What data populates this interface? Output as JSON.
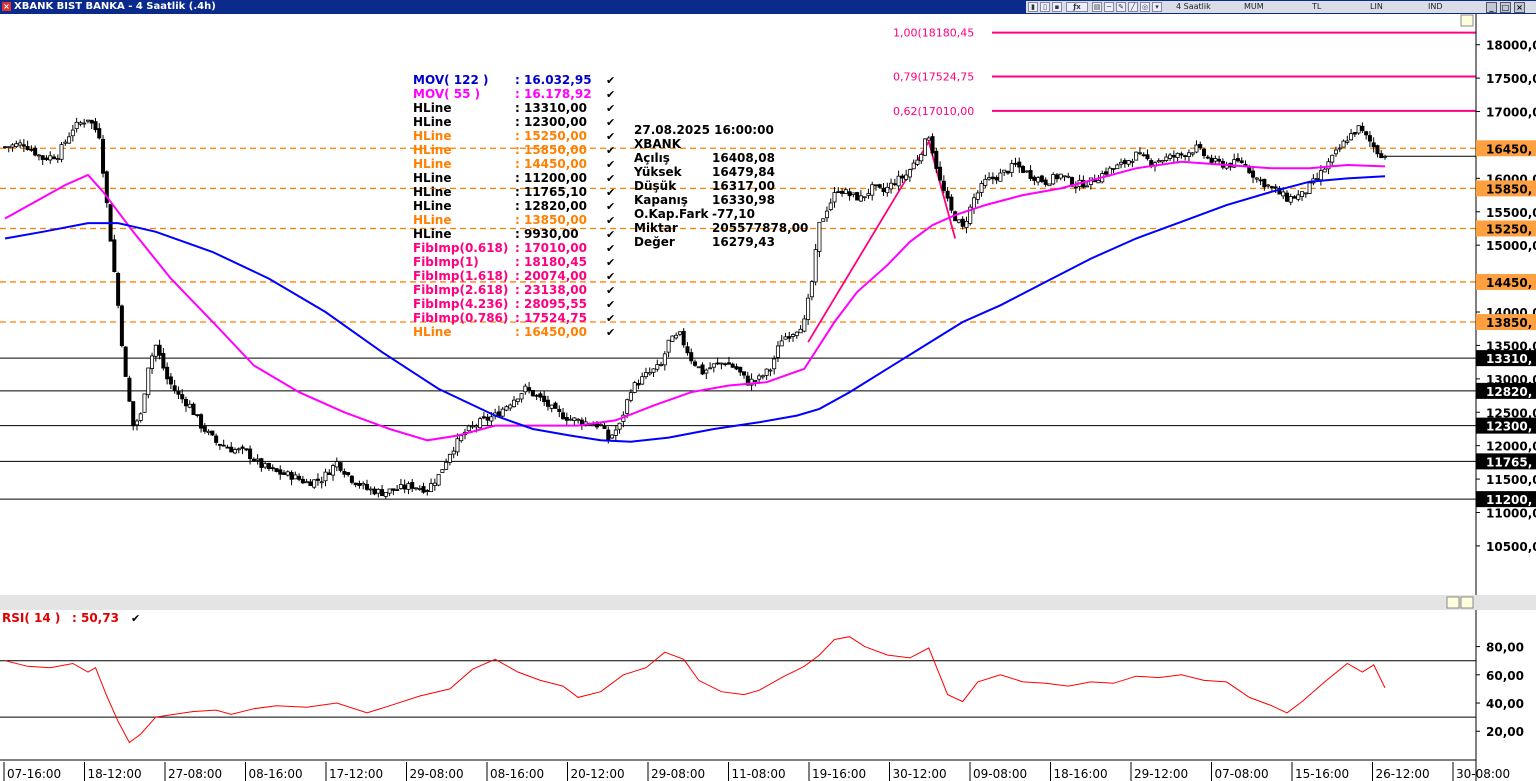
{
  "window": {
    "title": "XBANK BIST BANKA - 4 Saatlik (.4h)"
  },
  "toolbar": {
    "items": [
      "4 Saatlik",
      "MUM",
      "TL",
      "LIN",
      "IND"
    ]
  },
  "colors": {
    "mov122": "#0000ff",
    "mov55": "#ff00ff",
    "hline_black": "#000000",
    "hline_orange": "#ff8000",
    "fib": "#ff0080",
    "rsi": "#ff0000"
  },
  "legend": [
    {
      "name": "MOV( 122 )",
      "value": ": 16.032,95",
      "color": "#0000cc"
    },
    {
      "name": "MOV( 55 )",
      "value": ": 16.178,92",
      "color": "#ff00ff"
    },
    {
      "name": "HLine",
      "value": ": 13310,00",
      "color": "#000000"
    },
    {
      "name": "HLine",
      "value": ": 12300,00",
      "color": "#000000"
    },
    {
      "name": "HLine",
      "value": ": 15250,00",
      "color": "#ff8000"
    },
    {
      "name": "HLine",
      "value": ": 15850,00",
      "color": "#ff8000"
    },
    {
      "name": "HLine",
      "value": ": 14450,00",
      "color": "#ff8000"
    },
    {
      "name": "HLine",
      "value": ": 11200,00",
      "color": "#000000"
    },
    {
      "name": "HLine",
      "value": ": 11765,10",
      "color": "#000000"
    },
    {
      "name": "HLine",
      "value": ": 12820,00",
      "color": "#000000"
    },
    {
      "name": "HLine",
      "value": ": 13850,00",
      "color": "#ff8000"
    },
    {
      "name": "HLine",
      "value": ": 9930,00",
      "color": "#000000"
    },
    {
      "name": "FibImp(0.618)",
      "value": ": 17010,00",
      "color": "#ff0080"
    },
    {
      "name": "FibImp(1)",
      "value": ": 18180,45",
      "color": "#ff0080"
    },
    {
      "name": "FibImp(1.618)",
      "value": ": 20074,00",
      "color": "#ff0080"
    },
    {
      "name": "FibImp(2.618)",
      "value": ": 23138,00",
      "color": "#ff0080"
    },
    {
      "name": "FibImp(4.236)",
      "value": ": 28095,55",
      "color": "#ff0080"
    },
    {
      "name": "FibImp(0.786)",
      "value": ": 17524,75",
      "color": "#ff0080"
    },
    {
      "name": "HLine",
      "value": ": 16450,00",
      "color": "#ff8000"
    }
  ],
  "info": {
    "datetime": "27.08.2025  16:00:00",
    "symbol": "XBANK",
    "rows": [
      {
        "label": "Açılış",
        "value": "16408,08"
      },
      {
        "label": "Yüksek",
        "value": "16479,84"
      },
      {
        "label": "Düşük",
        "value": "16317,00"
      },
      {
        "label": "Kapanış",
        "value": "16330,98"
      },
      {
        "label": "O.Kap.Fark",
        "value": "-77,10"
      },
      {
        "label": "Miktar",
        "value": "205577878,00"
      },
      {
        "label": "Değer",
        "value": "16279,43"
      }
    ]
  },
  "rsi": {
    "label": "RSI( 14 )",
    "value": ": 50,73"
  },
  "chart_data": [
    {
      "type": "candlestick",
      "title": "XBANK BIST BANKA - 4 Saatlik (.4h)",
      "x_tick_labels": [
        "07-16:00",
        "18-12:00",
        "27-08:00",
        "08-16:00",
        "17-12:00",
        "29-08:00",
        "08-16:00",
        "20-12:00",
        "29-08:00",
        "11-08:00",
        "19-16:00",
        "30-12:00",
        "09-08:00",
        "18-16:00",
        "29-12:00",
        "07-08:00",
        "15-16:00",
        "26-12:00",
        "30-08:00"
      ],
      "y_ticks": [
        10500,
        11000,
        11500,
        12000,
        12500,
        13000,
        13500,
        14000,
        14500,
        15000,
        15500,
        16000,
        16500,
        17000,
        17500,
        18000
      ],
      "y_tick_labels": [
        "10500,0",
        "11000,0",
        "11500,0",
        "12000,0",
        "12500,0",
        "13000,0",
        "13500,0",
        "14000,0",
        "14500,0",
        "15000,0",
        "15500,0",
        "16000,0",
        "16500,0",
        "17000,0",
        "17500,0",
        "18000,0"
      ],
      "ylim": [
        9930,
        18220
      ],
      "hlines_black": [
        {
          "value": 13310,
          "label": "13310,"
        },
        {
          "value": 12820,
          "label": "12820,"
        },
        {
          "value": 12300,
          "label": "12300,"
        },
        {
          "value": 11765.1,
          "label": "11765,"
        },
        {
          "value": 11200,
          "label": "11200,"
        }
      ],
      "hlines_orange": [
        {
          "value": 16450,
          "label": "16450,"
        },
        {
          "value": 15850,
          "label": "15850,"
        },
        {
          "value": 15250,
          "label": "15250,"
        },
        {
          "value": 14450,
          "label": "14450,"
        },
        {
          "value": 13850,
          "label": "13850,"
        }
      ],
      "fib_lines": [
        {
          "value": 18180.45,
          "label": "1,00(18180,45"
        },
        {
          "value": 17524.75,
          "label": "0,79(17524,75"
        },
        {
          "value": 17010,
          "label": "0,62(17010,00"
        }
      ],
      "price_path": [
        [
          0,
          16470
        ],
        [
          5,
          16520
        ],
        [
          10,
          16300
        ],
        [
          14,
          16350
        ],
        [
          18,
          16750
        ],
        [
          22,
          16900
        ],
        [
          25,
          16650
        ],
        [
          28,
          15100
        ],
        [
          30,
          14100
        ],
        [
          32,
          13000
        ],
        [
          34,
          12300
        ],
        [
          36,
          12450
        ],
        [
          38,
          13200
        ],
        [
          40,
          13500
        ],
        [
          43,
          13000
        ],
        [
          46,
          12750
        ],
        [
          49,
          12600
        ],
        [
          52,
          12300
        ],
        [
          56,
          12050
        ],
        [
          60,
          11950
        ],
        [
          64,
          11900
        ],
        [
          68,
          11700
        ],
        [
          72,
          11600
        ],
        [
          76,
          11550
        ],
        [
          80,
          11450
        ],
        [
          84,
          11500
        ],
        [
          88,
          11750
        ],
        [
          92,
          11500
        ],
        [
          96,
          11350
        ],
        [
          100,
          11300
        ],
        [
          104,
          11350
        ],
        [
          108,
          11400
        ],
        [
          112,
          11350
        ],
        [
          115,
          11550
        ],
        [
          118,
          11900
        ],
        [
          122,
          12200
        ],
        [
          126,
          12350
        ],
        [
          130,
          12450
        ],
        [
          134,
          12650
        ],
        [
          138,
          12850
        ],
        [
          142,
          12700
        ],
        [
          146,
          12500
        ],
        [
          150,
          12400
        ],
        [
          154,
          12350
        ],
        [
          158,
          12300
        ],
        [
          160,
          12100
        ],
        [
          163,
          12300
        ],
        [
          166,
          12850
        ],
        [
          170,
          13050
        ],
        [
          174,
          13200
        ],
        [
          176,
          13550
        ],
        [
          179,
          13650
        ],
        [
          182,
          13300
        ],
        [
          185,
          13100
        ],
        [
          188,
          13200
        ],
        [
          191,
          13250
        ],
        [
          194,
          13150
        ],
        [
          197,
          12950
        ],
        [
          200,
          13000
        ],
        [
          203,
          13150
        ],
        [
          206,
          13600
        ],
        [
          209,
          13700
        ],
        [
          212,
          13850
        ],
        [
          214,
          14450
        ],
        [
          216,
          15300
        ],
        [
          218,
          15550
        ],
        [
          221,
          15850
        ],
        [
          224,
          15750
        ],
        [
          227,
          15700
        ],
        [
          230,
          15850
        ],
        [
          233,
          15800
        ],
        [
          236,
          15950
        ],
        [
          239,
          16050
        ],
        [
          242,
          16300
        ],
        [
          245,
          16650
        ],
        [
          248,
          15950
        ],
        [
          251,
          15500
        ],
        [
          254,
          15250
        ],
        [
          257,
          15700
        ],
        [
          260,
          15950
        ],
        [
          264,
          16050
        ],
        [
          268,
          16200
        ],
        [
          272,
          16050
        ],
        [
          276,
          15950
        ],
        [
          280,
          16050
        ],
        [
          284,
          15900
        ],
        [
          288,
          15950
        ],
        [
          292,
          16100
        ],
        [
          296,
          16200
        ],
        [
          300,
          16350
        ],
        [
          304,
          16250
        ],
        [
          308,
          16300
        ],
        [
          312,
          16350
        ],
        [
          316,
          16450
        ],
        [
          320,
          16250
        ],
        [
          324,
          16200
        ],
        [
          328,
          16250
        ],
        [
          332,
          16000
        ],
        [
          336,
          15850
        ],
        [
          340,
          15700
        ],
        [
          344,
          15750
        ],
        [
          348,
          16000
        ],
        [
          352,
          16300
        ],
        [
          356,
          16600
        ],
        [
          359,
          16750
        ],
        [
          362,
          16550
        ],
        [
          364,
          16400
        ],
        [
          366,
          16330
        ]
      ],
      "mov_122_path": [
        [
          0,
          15100
        ],
        [
          10,
          15200
        ],
        [
          22,
          15330
        ],
        [
          30,
          15330
        ],
        [
          40,
          15200
        ],
        [
          55,
          14900
        ],
        [
          70,
          14500
        ],
        [
          85,
          14000
        ],
        [
          100,
          13400
        ],
        [
          115,
          12850
        ],
        [
          130,
          12450
        ],
        [
          140,
          12250
        ],
        [
          150,
          12150
        ],
        [
          158,
          12080
        ],
        [
          166,
          12060
        ],
        [
          176,
          12120
        ],
        [
          188,
          12250
        ],
        [
          200,
          12350
        ],
        [
          210,
          12450
        ],
        [
          216,
          12550
        ],
        [
          224,
          12800
        ],
        [
          234,
          13150
        ],
        [
          244,
          13500
        ],
        [
          254,
          13850
        ],
        [
          264,
          14100
        ],
        [
          276,
          14450
        ],
        [
          288,
          14800
        ],
        [
          300,
          15100
        ],
        [
          312,
          15350
        ],
        [
          324,
          15600
        ],
        [
          336,
          15800
        ],
        [
          346,
          15950
        ],
        [
          356,
          16000
        ],
        [
          366,
          16032.95
        ]
      ],
      "mov_55_path": [
        [
          0,
          15400
        ],
        [
          8,
          15650
        ],
        [
          16,
          15900
        ],
        [
          22,
          16050
        ],
        [
          26,
          15800
        ],
        [
          34,
          15200
        ],
        [
          44,
          14500
        ],
        [
          56,
          13800
        ],
        [
          66,
          13200
        ],
        [
          78,
          12800
        ],
        [
          90,
          12500
        ],
        [
          102,
          12250
        ],
        [
          112,
          12080
        ],
        [
          120,
          12150
        ],
        [
          130,
          12300
        ],
        [
          142,
          12300
        ],
        [
          152,
          12300
        ],
        [
          162,
          12380
        ],
        [
          172,
          12600
        ],
        [
          182,
          12800
        ],
        [
          192,
          12900
        ],
        [
          202,
          12950
        ],
        [
          212,
          13150
        ],
        [
          220,
          13850
        ],
        [
          226,
          14300
        ],
        [
          234,
          14700
        ],
        [
          240,
          15050
        ],
        [
          246,
          15300
        ],
        [
          252,
          15450
        ],
        [
          260,
          15600
        ],
        [
          270,
          15750
        ],
        [
          280,
          15850
        ],
        [
          290,
          16000
        ],
        [
          300,
          16150
        ],
        [
          312,
          16250
        ],
        [
          324,
          16200
        ],
        [
          336,
          16150
        ],
        [
          346,
          16150
        ],
        [
          356,
          16200
        ],
        [
          366,
          16178.92
        ]
      ],
      "fib_swing": [
        [
          213,
          13550
        ],
        [
          245,
          16550
        ],
        [
          252,
          15100
        ]
      ]
    },
    {
      "type": "line",
      "series": [
        {
          "name": "RSI( 14 )",
          "current": 50.73
        }
      ],
      "y_ticks": [
        20,
        40,
        60,
        80
      ],
      "y_tick_labels": [
        "20,00",
        "40,00",
        "60,00",
        "80,00"
      ],
      "ylim": [
        6,
        96
      ],
      "hlines": [
        70,
        30
      ],
      "rsi_path": [
        [
          0,
          70
        ],
        [
          6,
          66
        ],
        [
          12,
          65
        ],
        [
          18,
          68
        ],
        [
          22,
          62
        ],
        [
          24,
          65
        ],
        [
          27,
          45
        ],
        [
          30,
          27
        ],
        [
          33,
          12
        ],
        [
          36,
          18
        ],
        [
          40,
          30
        ],
        [
          45,
          32
        ],
        [
          50,
          34
        ],
        [
          56,
          35
        ],
        [
          60,
          32
        ],
        [
          66,
          36
        ],
        [
          72,
          38
        ],
        [
          80,
          37
        ],
        [
          88,
          40
        ],
        [
          96,
          33
        ],
        [
          102,
          38
        ],
        [
          110,
          45
        ],
        [
          118,
          50
        ],
        [
          124,
          64
        ],
        [
          130,
          71
        ],
        [
          136,
          62
        ],
        [
          142,
          56
        ],
        [
          148,
          52
        ],
        [
          152,
          44
        ],
        [
          158,
          48
        ],
        [
          164,
          60
        ],
        [
          170,
          65
        ],
        [
          175,
          76
        ],
        [
          180,
          71
        ],
        [
          184,
          56
        ],
        [
          190,
          48
        ],
        [
          196,
          46
        ],
        [
          200,
          49
        ],
        [
          206,
          58
        ],
        [
          212,
          66
        ],
        [
          216,
          74
        ],
        [
          220,
          85
        ],
        [
          224,
          87
        ],
        [
          228,
          80
        ],
        [
          234,
          74
        ],
        [
          240,
          72
        ],
        [
          245,
          79
        ],
        [
          250,
          46
        ],
        [
          254,
          41
        ],
        [
          258,
          55
        ],
        [
          264,
          60
        ],
        [
          270,
          55
        ],
        [
          276,
          54
        ],
        [
          282,
          52
        ],
        [
          288,
          55
        ],
        [
          294,
          54
        ],
        [
          300,
          59
        ],
        [
          306,
          58
        ],
        [
          312,
          60
        ],
        [
          318,
          56
        ],
        [
          324,
          55
        ],
        [
          330,
          44
        ],
        [
          336,
          38
        ],
        [
          340,
          33
        ],
        [
          344,
          41
        ],
        [
          350,
          55
        ],
        [
          356,
          68
        ],
        [
          360,
          62
        ],
        [
          363,
          67
        ],
        [
          366,
          50.73
        ]
      ]
    }
  ]
}
